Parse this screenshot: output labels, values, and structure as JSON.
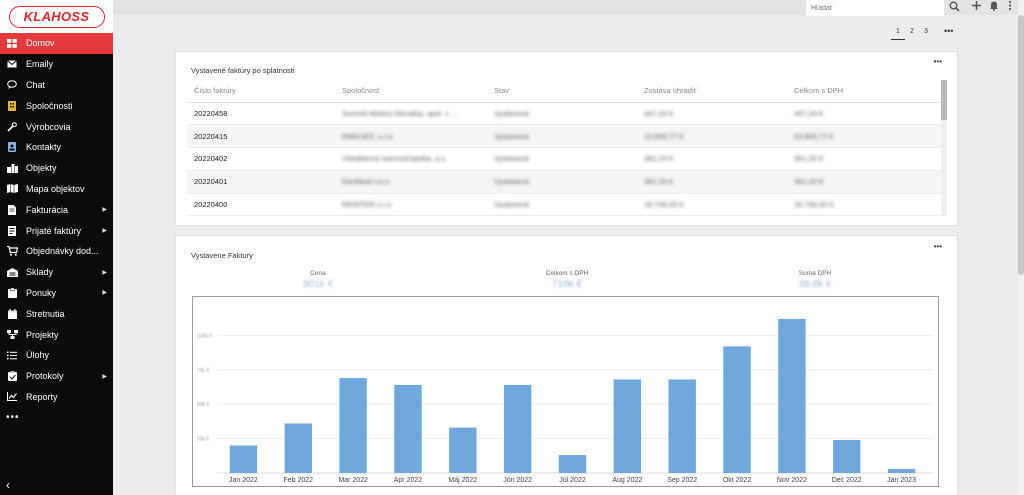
{
  "brand": {
    "logo_text": "KLAHOSS"
  },
  "sidebar": {
    "items": [
      {
        "label": "Domov",
        "icon": "dashboard-icon",
        "active": true,
        "submenu": false
      },
      {
        "label": "Emaily",
        "icon": "envelope-icon",
        "active": false,
        "submenu": false
      },
      {
        "label": "Chat",
        "icon": "chat-bubble-icon",
        "active": false,
        "submenu": false
      },
      {
        "label": "Spoločnosti",
        "icon": "building-icon",
        "active": false,
        "submenu": false
      },
      {
        "label": "Výrobcovia",
        "icon": "wrench-icon",
        "active": false,
        "submenu": false
      },
      {
        "label": "Kontakty",
        "icon": "contact-card-icon",
        "active": false,
        "submenu": false
      },
      {
        "label": "Objekty",
        "icon": "city-icon",
        "active": false,
        "submenu": false
      },
      {
        "label": "Mapa objektov",
        "icon": "map-icon",
        "active": false,
        "submenu": false
      },
      {
        "label": "Fakturácia",
        "icon": "invoice-icon",
        "active": false,
        "submenu": true
      },
      {
        "label": "Prijaté faktúry",
        "icon": "received-invoice-icon",
        "active": false,
        "submenu": true
      },
      {
        "label": "Objednávky dod...",
        "icon": "cart-icon",
        "active": false,
        "submenu": false
      },
      {
        "label": "Sklady",
        "icon": "warehouse-icon",
        "active": false,
        "submenu": true
      },
      {
        "label": "Ponuky",
        "icon": "offer-icon",
        "active": false,
        "submenu": true
      },
      {
        "label": "Stretnutia",
        "icon": "calendar-icon",
        "active": false,
        "submenu": false
      },
      {
        "label": "Projekty",
        "icon": "project-tree-icon",
        "active": false,
        "submenu": false
      },
      {
        "label": "Úlohy",
        "icon": "task-list-icon",
        "active": false,
        "submenu": false
      },
      {
        "label": "Protokoly",
        "icon": "protocol-icon",
        "active": false,
        "submenu": true
      },
      {
        "label": "Reporty",
        "icon": "chart-icon",
        "active": false,
        "submenu": false
      }
    ],
    "more_label": "•••",
    "collapse_label": "‹"
  },
  "topbar": {
    "search_placeholder": "Hľadať"
  },
  "pager": {
    "pages": [
      "1",
      "2",
      "3"
    ],
    "current": "1",
    "more": "•••"
  },
  "invoices_panel": {
    "title": "Vystavené faktúry po splatnosti",
    "menu": "•••",
    "columns": [
      "Číslo faktúry",
      "Spoločnosť",
      "Stav",
      "Zostáva uhradiť",
      "Celkom s DPH"
    ],
    "rows": [
      {
        "number": "20220458",
        "company": "Summit Motors Slovakia, spol. s ...",
        "status": "Vystavená",
        "remaining": "447,24 €",
        "total": "447,24 €"
      },
      {
        "number": "20220415",
        "company": "PARCIEZ, s.r.o.",
        "status": "Vystavená",
        "remaining": "23.800,77 €",
        "total": "23.800,77 €"
      },
      {
        "number": "20220402",
        "company": "Všeobecná úverová banka, a.s.",
        "status": "Vystavená",
        "remaining": "361,20 €",
        "total": "361,20 €"
      },
      {
        "number": "20220401",
        "company": "Kaufland v.o.s.",
        "status": "Vystavená",
        "remaining": "361,20 €",
        "total": "361,20 €"
      },
      {
        "number": "20220400",
        "company": "REINTER s.r.o.",
        "status": "Vystavená",
        "remaining": "16.749,45 €",
        "total": "16.749,45 €"
      }
    ]
  },
  "chart_panel": {
    "title": "Vystavene Faktury",
    "menu": "•••",
    "kpis": [
      {
        "label": "Cena",
        "value": "801k €"
      },
      {
        "label": "Celkom s DPH",
        "value": "718k €"
      },
      {
        "label": "Suma DPH",
        "value": "38.8k €"
      }
    ]
  },
  "chart_data": {
    "type": "bar",
    "title": "Vystavene Faktury",
    "categories": [
      "Jan 2022",
      "Feb 2022",
      "Mar 2022",
      "Apr 2022",
      "Máj 2022",
      "Jún 2022",
      "Júl 2022",
      "Aug 2022",
      "Sep 2022",
      "Okt 2022",
      "Nov 2022",
      "Dec 2022",
      "Jan 2023"
    ],
    "values": [
      20,
      36,
      69,
      64,
      33,
      64,
      13,
      68,
      68,
      92,
      112,
      24,
      3
    ],
    "yticks": [
      "25k €",
      "50k €",
      "75k €",
      "100k €"
    ],
    "ylim": [
      0,
      125
    ],
    "grid": true,
    "bar_color": "#6fa8dc"
  }
}
